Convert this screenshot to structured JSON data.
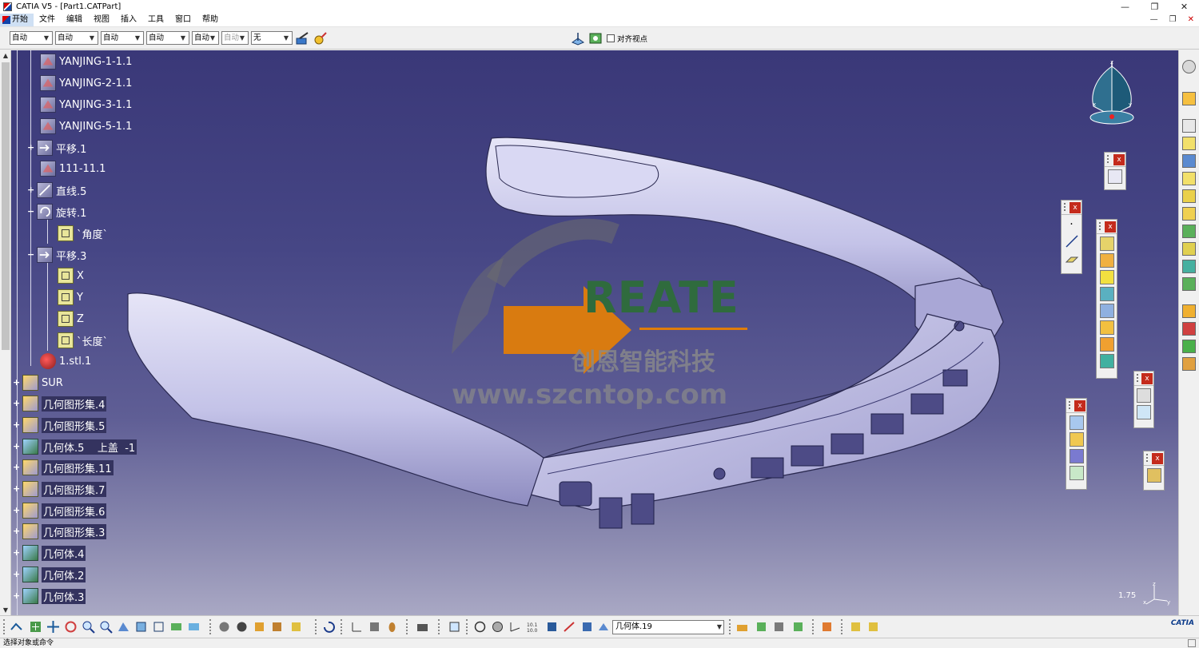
{
  "window": {
    "title": "CATIA V5 - [Part1.CATPart]",
    "minimize_glyph": "—",
    "maximize_glyph": "❐",
    "close_glyph": "✕"
  },
  "menu": {
    "items": [
      "开始",
      "文件",
      "编辑",
      "视图",
      "插入",
      "工具",
      "窗口",
      "帮助"
    ],
    "doc_buttons": [
      "—",
      "❐",
      "✕"
    ]
  },
  "top_toolbar": {
    "combos": [
      {
        "value": "自动",
        "disabled": false
      },
      {
        "value": "自动",
        "disabled": false
      },
      {
        "value": "自动",
        "disabled": false
      },
      {
        "value": "自动",
        "disabled": false
      },
      {
        "value": "自动",
        "disabled": false
      },
      {
        "value": "自动",
        "disabled": true
      },
      {
        "value": "无",
        "disabled": false
      }
    ],
    "align_viewpoint_label": "对齐视点"
  },
  "tree": {
    "nodes": [
      {
        "label": "YANJING-1-1.1",
        "icon": "geometry-icon"
      },
      {
        "label": "YANJING-2-1.1",
        "icon": "geometry-icon"
      },
      {
        "label": "YANJING-3-1.1",
        "icon": "geometry-icon"
      },
      {
        "label": "YANJING-5-1.1",
        "icon": "geometry-icon"
      },
      {
        "label": "平移.1",
        "icon": "translate-icon"
      },
      {
        "label": "111-11.1",
        "icon": "geometry-icon"
      },
      {
        "label": "直线.5",
        "icon": "line-icon"
      },
      {
        "label": "旋转.1",
        "icon": "rotate-icon"
      },
      {
        "label": "`角度`",
        "icon": "parameter-icon"
      },
      {
        "label": "平移.3",
        "icon": "translate-icon"
      },
      {
        "label": "X",
        "icon": "parameter-icon"
      },
      {
        "label": "Y",
        "icon": "parameter-icon"
      },
      {
        "label": "Z",
        "icon": "parameter-icon"
      },
      {
        "label": "`长度`",
        "icon": "parameter-icon"
      },
      {
        "label": "1.stl.1",
        "icon": "stl-icon"
      },
      {
        "label": "SUR",
        "icon": "geometrical-set-icon"
      },
      {
        "label": "几何图形集.4",
        "icon": "geometrical-set-icon"
      },
      {
        "label": "几何图形集.5",
        "icon": "geometrical-set-icon"
      },
      {
        "label": "几何体.5    上盖  -1",
        "icon": "body-icon"
      },
      {
        "label": "几何图形集.11",
        "icon": "geometrical-set-icon"
      },
      {
        "label": "几何图形集.7",
        "icon": "geometrical-set-icon"
      },
      {
        "label": "几何图形集.6",
        "icon": "geometrical-set-icon"
      },
      {
        "label": "几何图形集.3",
        "icon": "geometrical-set-icon"
      },
      {
        "label": "几何体.4",
        "icon": "body-icon"
      },
      {
        "label": "几何体.2",
        "icon": "body-icon"
      },
      {
        "label": "几何体.3",
        "icon": "body-icon"
      }
    ]
  },
  "viewport": {
    "watermark_brand": "REATE",
    "watermark_company": "创恩智能科技",
    "watermark_url": "www.szcntop.com",
    "zoom_readout": "1.75",
    "axis_x": "x",
    "axis_y": "y",
    "axis_z": "z"
  },
  "bottom_toolbar": {
    "current_body": "几何体.19",
    "logo_text": "CATIA"
  },
  "status": {
    "prompt": "选择对象或命令"
  },
  "colors": {
    "viewport_top": "#3a3878",
    "viewport_bottom": "#a9a8c4",
    "watermark_orange": "#e07d0a",
    "watermark_green": "#2f6b3d",
    "model_fill": "#c4c3e8"
  }
}
